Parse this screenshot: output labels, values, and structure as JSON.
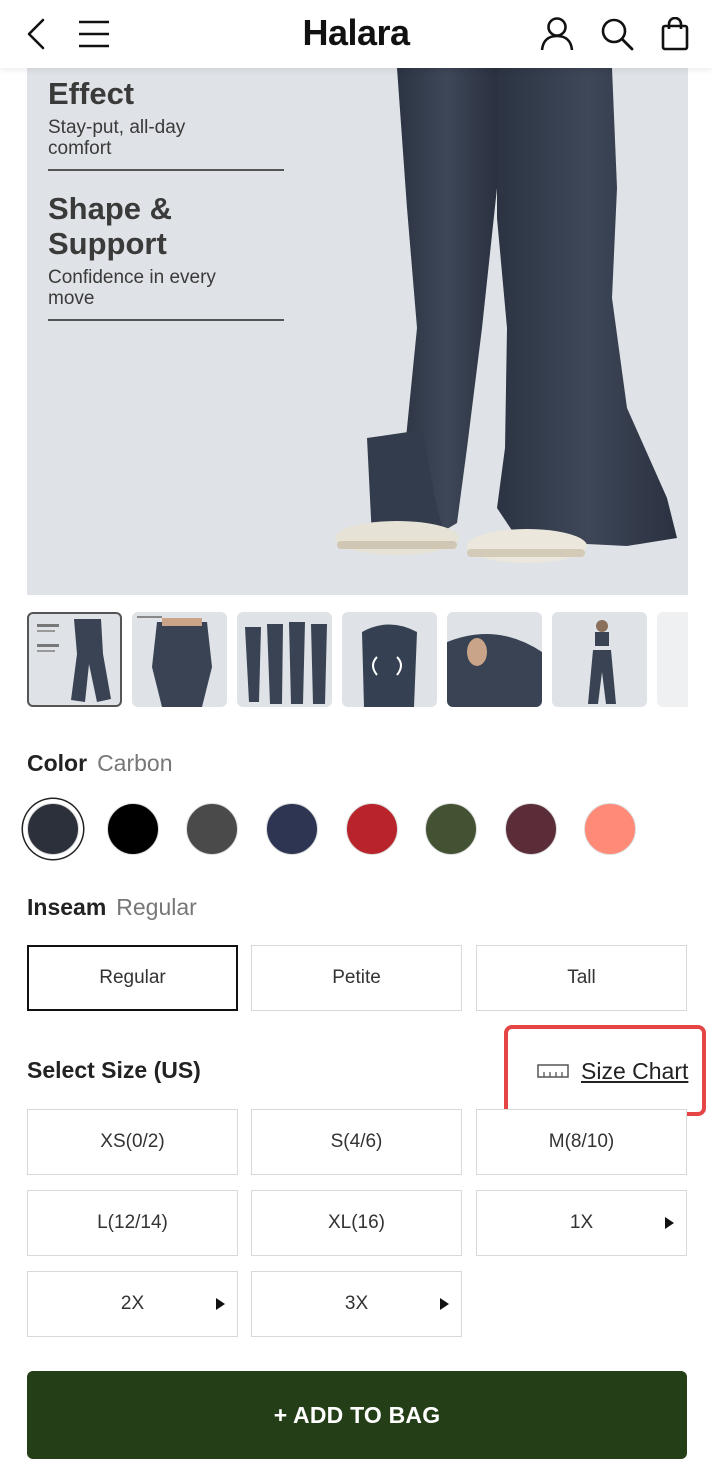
{
  "header": {
    "brand": "Halara"
  },
  "hero": {
    "blocks": [
      {
        "heading": "Effect",
        "text": "Stay-put, all-day comfort"
      },
      {
        "heading": "Shape & Support",
        "text": "Confidence in every move"
      }
    ]
  },
  "color": {
    "label": "Color",
    "selected": "Carbon",
    "swatches": [
      "#2b303a",
      "#000000",
      "#4a4a4a",
      "#2e3552",
      "#b8232c",
      "#435233",
      "#5a2d38",
      "#ff8a78"
    ]
  },
  "inseam": {
    "label": "Inseam",
    "selected": "Regular",
    "options": [
      "Regular",
      "Petite",
      "Tall"
    ]
  },
  "size": {
    "label": "Select Size (US)",
    "chart_label": "Size Chart",
    "options": [
      "XS(0/2)",
      "S(4/6)",
      "M(8/10)",
      "L(12/14)",
      "XL(16)",
      "1X",
      "2X",
      "3X"
    ]
  },
  "cta": {
    "add_to_bag": "+ ADD TO BAG"
  }
}
